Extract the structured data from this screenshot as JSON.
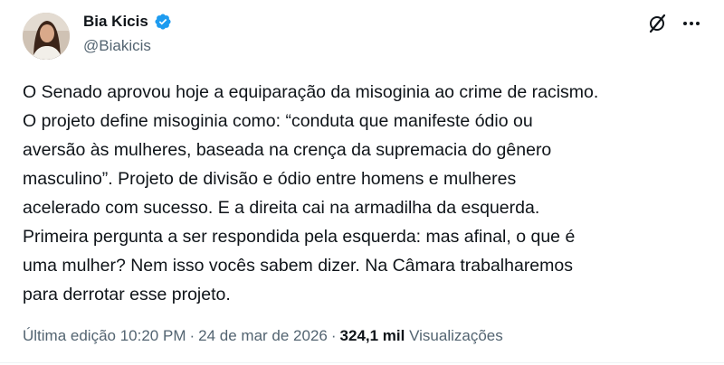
{
  "author": {
    "name": "Bia Kicis",
    "handle": "@Biakicis",
    "verified": true
  },
  "post": {
    "text": "O Senado aprovou hoje a equiparação da misoginia ao crime de racismo.\nO projeto define misoginia como: “conduta que manifeste ódio ou\naversão às mulheres, baseada na crença da supremacia do gênero\nmasculino”. Projeto de divisão e ódio entre homens e mulheres\nacelerado com sucesso. E a direita cai na armadilha da esquerda.\nPrimeira pergunta a ser respondida pela esquerda: mas afinal, o que é\numa mulher? Nem isso vocês sabem dizer. Na Câmara trabalharemos\npara derrotar esse projeto."
  },
  "meta": {
    "edited_label": "Última edição 10:20 PM",
    "separator": "·",
    "date": "24 de mar de 2026",
    "views_count": "324,1 mil",
    "views_label": "Visualizações"
  },
  "icons": {
    "verified": "verified-badge-icon",
    "grok": "grok-icon",
    "more": "more-options-icon"
  },
  "colors": {
    "verified": "#1d9bf0",
    "text": "#0f1419",
    "secondary": "#536471"
  }
}
